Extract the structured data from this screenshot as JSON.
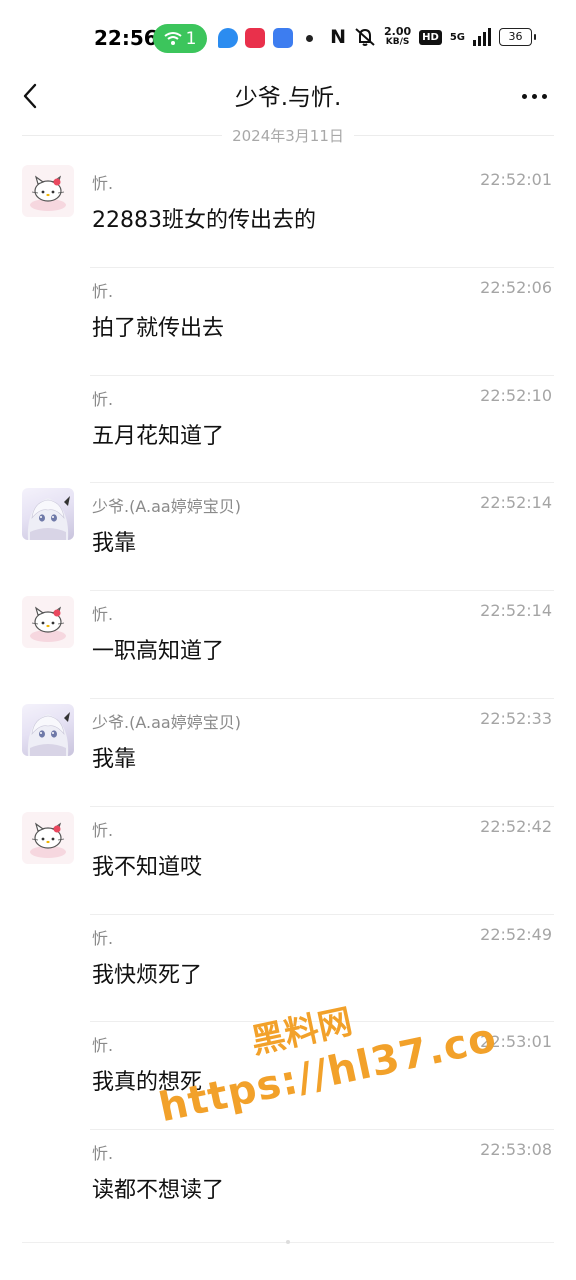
{
  "status_bar": {
    "time": "22:56",
    "wifi_count": "1",
    "nfc": "N",
    "speed_value": "2.00",
    "speed_unit": "KB/S",
    "hd": "HD",
    "network": "5G",
    "battery": "36"
  },
  "header": {
    "title": "少爷.与忻."
  },
  "date_separator": "2024年3月11日",
  "messages": [
    {
      "sender": "忻.",
      "time": "22:52:01",
      "text": "22883班女的传出去的",
      "avatar": "kitty"
    },
    {
      "sender": "忻.",
      "time": "22:52:06",
      "text": "拍了就传出去",
      "avatar": ""
    },
    {
      "sender": "忻.",
      "time": "22:52:10",
      "text": "五月花知道了",
      "avatar": ""
    },
    {
      "sender": "少爷.(A.aa婷婷宝贝)",
      "time": "22:52:14",
      "text": "我靠",
      "avatar": "anime"
    },
    {
      "sender": "忻.",
      "time": "22:52:14",
      "text": "一职高知道了",
      "avatar": "kitty"
    },
    {
      "sender": "少爷.(A.aa婷婷宝贝)",
      "time": "22:52:33",
      "text": "我靠",
      "avatar": "anime"
    },
    {
      "sender": "忻.",
      "time": "22:52:42",
      "text": "我不知道哎",
      "avatar": "kitty"
    },
    {
      "sender": "忻.",
      "time": "22:52:49",
      "text": "我快烦死了",
      "avatar": ""
    },
    {
      "sender": "忻.",
      "time": "22:53:01",
      "text": "我真的想死",
      "avatar": ""
    },
    {
      "sender": "忻.",
      "time": "22:53:08",
      "text": "读都不想读了",
      "avatar": ""
    }
  ],
  "watermark": {
    "line1": "黑料网",
    "line2": "https://hl37.co"
  },
  "colors": {
    "wifi_badge": "#3cc55c",
    "watermark": "#f2a12a",
    "meta_text": "#a5a5a5"
  }
}
